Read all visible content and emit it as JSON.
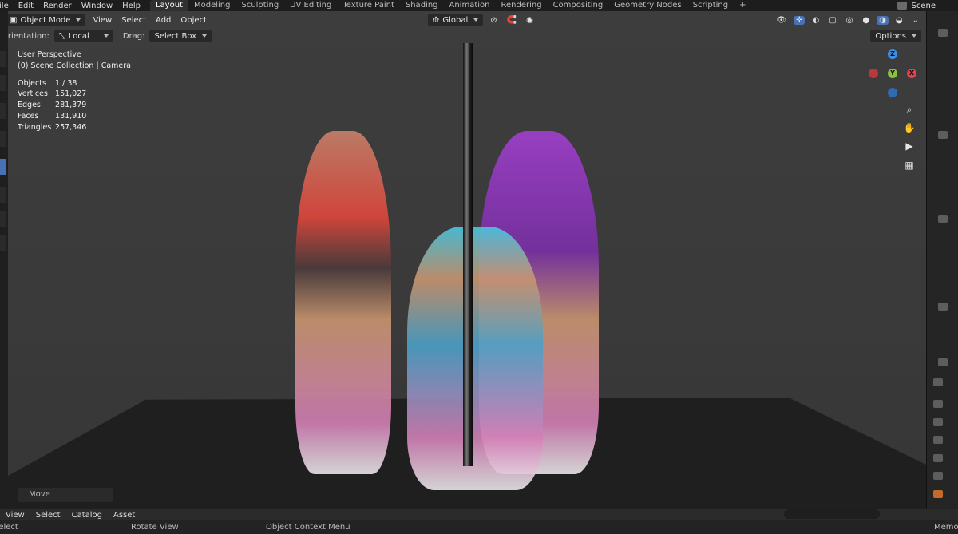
{
  "menu": [
    "File",
    "Edit",
    "Render",
    "Window",
    "Help"
  ],
  "workspaces": [
    "Layout",
    "Modeling",
    "Sculpting",
    "UV Editing",
    "Texture Paint",
    "Shading",
    "Animation",
    "Rendering",
    "Compositing",
    "Geometry Nodes",
    "Scripting",
    "+"
  ],
  "active_workspace": "Layout",
  "scene_name": "Scene",
  "header": {
    "mode": "Object Mode",
    "menus": [
      "View",
      "Select",
      "Add",
      "Object"
    ],
    "transform": "Global",
    "options": "Options"
  },
  "tool_settings": {
    "orientation_label": "Orientation:",
    "orientation_value": "Local",
    "drag_label": "Drag:",
    "drag_value": "Select Box"
  },
  "viewport_info": {
    "perspective": "User Perspective",
    "collection": "(0) Scene Collection | Camera",
    "stats": [
      {
        "k": "Objects",
        "v": "1 / 38"
      },
      {
        "k": "Vertices",
        "v": "151,027"
      },
      {
        "k": "Edges",
        "v": "281,379"
      },
      {
        "k": "Faces",
        "v": "131,910"
      },
      {
        "k": "Triangles",
        "v": "257,346"
      }
    ]
  },
  "gizmo": {
    "z": "Z",
    "y": "Y",
    "x": "X"
  },
  "last_operator": "Move",
  "bottom_menu": [
    "View",
    "Select",
    "Catalog",
    "Asset"
  ],
  "status": {
    "left": "Select",
    "rotate": "Rotate View",
    "context": "Object Context Menu",
    "memory": "Memo"
  },
  "colors": {
    "accent": "#4772b3",
    "gizmo_x": "#e04449",
    "gizmo_y": "#8bc23c",
    "gizmo_z": "#3d8ee6"
  }
}
